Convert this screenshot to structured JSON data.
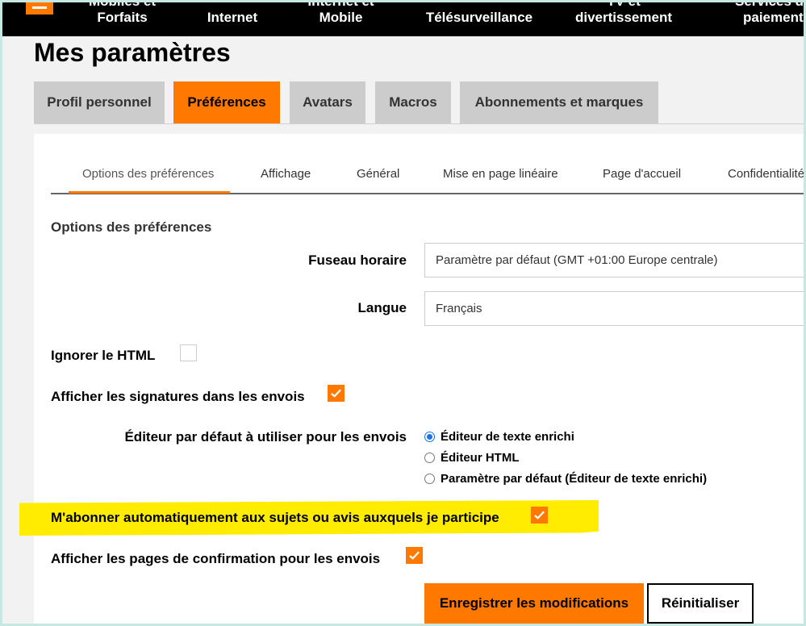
{
  "nav": {
    "items": [
      {
        "label_line1": "Mobiles et",
        "label_line2": "Forfaits"
      },
      {
        "label_line1": "",
        "label_line2": "Internet"
      },
      {
        "label_line1": "Internet et",
        "label_line2": "Mobile"
      },
      {
        "label_line1": "",
        "label_line2": "Télésurveillance"
      },
      {
        "label_line1": "TV et",
        "label_line2": "divertissement"
      },
      {
        "label_line1": "Services de",
        "label_line2": "paiement"
      }
    ]
  },
  "page_title": "Mes paramètres",
  "main_tabs": [
    {
      "label": "Profil personnel",
      "active": false
    },
    {
      "label": "Préférences",
      "active": true
    },
    {
      "label": "Avatars",
      "active": false
    },
    {
      "label": "Macros",
      "active": false
    },
    {
      "label": "Abonnements et marques",
      "active": false
    }
  ],
  "sub_tabs": [
    {
      "label": "Options des préférences",
      "active": true
    },
    {
      "label": "Affichage",
      "active": false
    },
    {
      "label": "Général",
      "active": false
    },
    {
      "label": "Mise en page linéaire",
      "active": false
    },
    {
      "label": "Page d'accueil",
      "active": false
    },
    {
      "label": "Confidentialité",
      "active": false
    }
  ],
  "section_title": "Options des préférences",
  "form": {
    "timezone": {
      "label": "Fuseau horaire",
      "value": "Paramètre par défaut (GMT +01:00 Europe centrale)"
    },
    "language": {
      "label": "Langue",
      "value": "Français"
    },
    "ignore_html": {
      "label": "Ignorer le HTML",
      "checked": false
    },
    "show_signatures": {
      "label": "Afficher les signatures dans les envois",
      "checked": true
    },
    "default_editor": {
      "label": "Éditeur par défaut à utiliser pour les envois",
      "options": [
        {
          "label": "Éditeur de texte enrichi",
          "selected": true
        },
        {
          "label": "Éditeur HTML",
          "selected": false
        },
        {
          "label": "Paramètre par défaut (Éditeur de texte enrichi)",
          "selected": false
        }
      ]
    },
    "auto_subscribe": {
      "label": "M'abonner automatiquement aux sujets ou avis auxquels je participe",
      "checked": true
    },
    "confirm_pages": {
      "label": "Afficher les pages de confirmation pour les envois",
      "checked": true
    }
  },
  "buttons": {
    "save": "Enregistrer les modifications",
    "reset": "Réinitialiser"
  },
  "colors": {
    "brand": "#ff7900",
    "highlight": "#ffec00",
    "radio_selected": "#1a73e8"
  }
}
